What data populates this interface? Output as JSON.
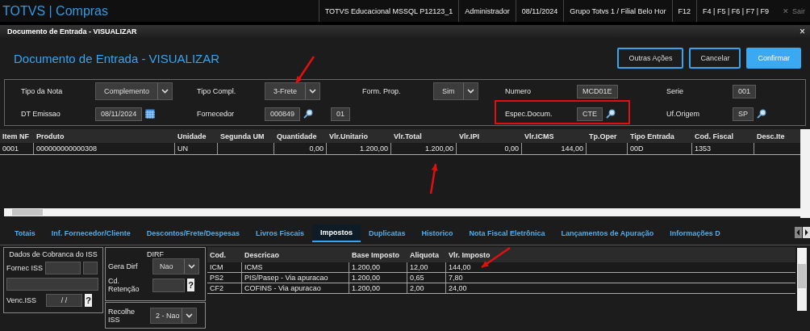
{
  "app_bar": {
    "title": "TOTVS | Compras",
    "items": [
      "TOTVS Educacional MSSQL P12123_1",
      "Administrador",
      "08/11/2024",
      "Grupo Totvs 1 / Filial Belo Hor",
      "F12",
      "F4 | F5 | F6 | F7 | F9"
    ],
    "exit": {
      "icon": "✕",
      "label": "Sair",
      "disabled": true
    }
  },
  "dialog": {
    "title": "Documento de Entrada - VISUALIZAR",
    "close": "×"
  },
  "header": {
    "title": "Documento de Entrada - VISUALIZAR",
    "buttons": [
      {
        "label": "Outras Ações",
        "kind": "outline"
      },
      {
        "label": "Cancelar",
        "kind": "outline"
      },
      {
        "label": "Confirmar",
        "kind": "primary"
      }
    ]
  },
  "form": {
    "rows": [
      [
        {
          "label": "Tipo da Nota",
          "value": "Complemento",
          "kind": "select"
        },
        {
          "label": "Tipo Compl.",
          "value": "3-Frete",
          "kind": "select"
        },
        {
          "label": "Form. Prop.",
          "value": "Sim",
          "kind": "select"
        },
        {
          "label": "Numero",
          "value": "MCD01E",
          "kind": "text"
        },
        {
          "label": "Serie",
          "value": "001",
          "kind": "text"
        }
      ],
      [
        {
          "label": "DT Emissao",
          "value": "08/11/2024",
          "kind": "date"
        },
        {
          "label": "Fornecedor",
          "value": "000849",
          "kind": "lookup",
          "extra": "01"
        },
        {
          "kind": "empty"
        },
        {
          "label": "Espec.Docum.",
          "value": "CTE",
          "kind": "lookup"
        },
        {
          "label": "Uf.Origem",
          "value": "SP",
          "kind": "lookup"
        }
      ]
    ]
  },
  "items_table": {
    "columns": [
      {
        "label": "Item NF",
        "kind": "text"
      },
      {
        "label": "Produto",
        "kind": "text"
      },
      {
        "label": "Unidade",
        "kind": "text"
      },
      {
        "label": "Segunda UM",
        "kind": "text"
      },
      {
        "label": "Quantidade",
        "kind": "number"
      },
      {
        "label": "Vlr.Unitario",
        "kind": "number"
      },
      {
        "label": "Vlr.Total",
        "kind": "number"
      },
      {
        "label": "Vlr.IPI",
        "kind": "number"
      },
      {
        "label": "Vlr.ICMS",
        "kind": "number"
      },
      {
        "label": "Tp.Oper",
        "kind": "text"
      },
      {
        "label": "Tipo Entrada",
        "kind": "text"
      },
      {
        "label": "Cod. Fiscal",
        "kind": "text"
      },
      {
        "label": "Desc.Ite",
        "kind": "text"
      }
    ],
    "rows": [
      [
        "0001",
        "000000000000308",
        "UN",
        "",
        "0,00",
        "1.200,00",
        "1.200,00",
        "0,00",
        "144,00",
        "",
        "00D",
        "1353",
        ""
      ]
    ]
  },
  "tabs": [
    {
      "label": "Totais",
      "selected": false
    },
    {
      "label": "Inf. Fornecedor/Cliente",
      "selected": false
    },
    {
      "label": "Descontos/Frete/Despesas",
      "selected": false
    },
    {
      "label": "Livros Fiscais",
      "selected": false
    },
    {
      "label": "Impostos",
      "selected": true
    },
    {
      "label": "Duplicatas",
      "selected": false
    },
    {
      "label": "Historico",
      "selected": false
    },
    {
      "label": "Nota Fiscal Eletrônica",
      "selected": false
    },
    {
      "label": "Lançamentos de Apuração",
      "selected": false
    },
    {
      "label": "Informações D",
      "selected": false
    }
  ],
  "iss": {
    "title": "Dados de Cobranca do ISS",
    "fornec_label": "Fornec ISS",
    "venc_label": "Venc.ISS",
    "venc_value": "/ /",
    "help": "?"
  },
  "dirf": {
    "title": "DIRF",
    "gera_label": "Gera Dirf",
    "gera_value": "Nao",
    "retencao_label": "Cd. Retenção",
    "help": "?"
  },
  "recolhe": {
    "label": "Recolhe ISS",
    "value": "2 - Nao"
  },
  "tax_table": {
    "columns": [
      "Cod.",
      "Descricao",
      "Base Imposto",
      "Aliquota",
      "Vlr. Imposto"
    ],
    "rows": [
      [
        "ICM",
        "ICMS",
        "1.200,00",
        "12,00",
        "144,00"
      ],
      [
        "PS2",
        "PIS/Pasep - Via apuracao",
        "1.200,00",
        "0,65",
        "7,80"
      ],
      [
        "CF2",
        "COFINS - Via apuracao",
        "1.200,00",
        "2,00",
        "24,00"
      ]
    ]
  }
}
